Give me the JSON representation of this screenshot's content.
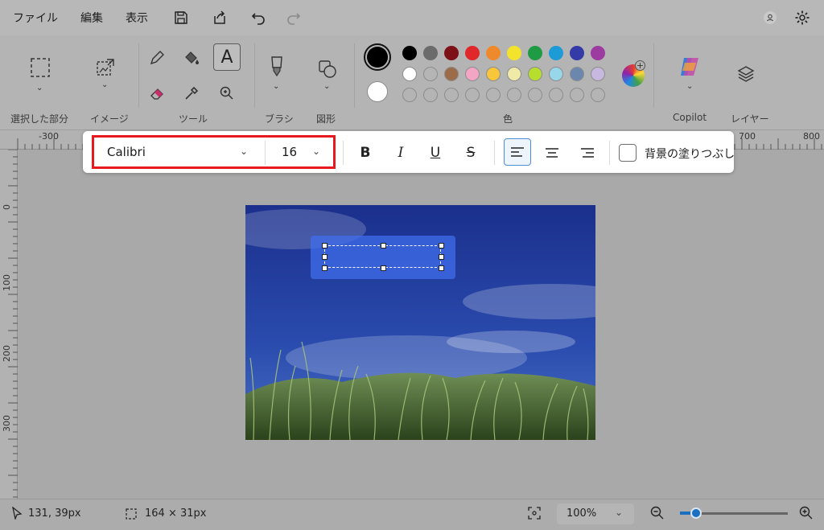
{
  "menu": {
    "file": "ファイル",
    "edit": "編集",
    "view": "表示"
  },
  "ribbon": {
    "selection_label": "選択した部分",
    "image_label": "イメージ",
    "tools_label": "ツール",
    "brush_label": "ブラシ",
    "shapes_label": "図形",
    "colors_label": "色",
    "copilot_label": "Copilot",
    "layers_label": "レイヤー",
    "swatches_row1": [
      "#000000",
      "#6b6b6b",
      "#7c1118",
      "#e0272a",
      "#ef8a2c",
      "#f4e32c",
      "#1e9b43",
      "#1d9bd6",
      "#343aa6",
      "#9c3ba0"
    ],
    "swatches_row2": [
      "#ffffff",
      "#b5b5b5",
      "#9c6b4a",
      "#f3a6c3",
      "#f7c63b",
      "#f0eaa8",
      "#b7dd2f",
      "#98d7ea",
      "#6c87ad",
      "#c7b8e0"
    ],
    "primary_color": "#000000",
    "secondary_color": "#ffffff"
  },
  "ruler": {
    "h_labels": [
      "-300",
      "700",
      "800"
    ],
    "v_labels": [
      "0",
      "100",
      "200",
      "300"
    ]
  },
  "text_toolbar": {
    "font": "Calibri",
    "size": "16",
    "fill_background_label": "背景の塗りつぶし",
    "bold": "B",
    "italic": "I",
    "underline": "U",
    "strike": "S"
  },
  "status": {
    "cursor_pos": "131, 39px",
    "selection_size": "164 × 31px",
    "zoom": "100%",
    "zoom_level_fraction": 0.15
  }
}
